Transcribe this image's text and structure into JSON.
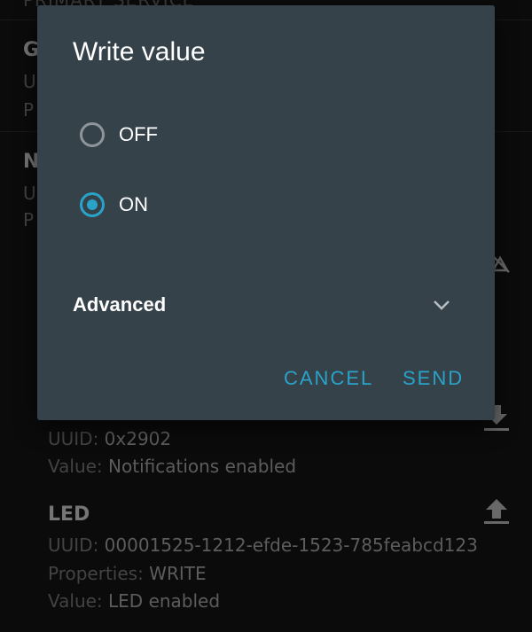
{
  "background": {
    "section_caption": "PRIMARY SERVICE",
    "char1": {
      "title_initial": "G",
      "uuid_initial": "U",
      "prop_initial": "P"
    },
    "char2": {
      "title_initial": "N",
      "uuid_initial": "U",
      "prop_initial": "P"
    },
    "descriptor": {
      "uuid_key": "UUID: ",
      "uuid_value": "0x2902",
      "value_key": "Value: ",
      "value_value": "Notifications enabled"
    },
    "led": {
      "title": "LED",
      "uuid_key": "UUID: ",
      "uuid_value": "00001525-1212-efde-1523-785feabcd123",
      "properties_key": "Properties: ",
      "properties_value": "WRITE",
      "value_key": "Value: ",
      "value_value": "LED enabled"
    }
  },
  "dialog": {
    "title": "Write value",
    "options": [
      {
        "label": "OFF",
        "checked": false
      },
      {
        "label": "ON",
        "checked": true
      }
    ],
    "advanced_label": "Advanced",
    "cancel_label": "CANCEL",
    "send_label": "SEND"
  },
  "colors": {
    "accent": "#2aa3c9",
    "dialog_bg": "#35424a",
    "screen_bg": "#141414"
  },
  "icons": [
    "notifications-off-icon",
    "download-icon",
    "upload-icon",
    "chevron-down-icon"
  ]
}
